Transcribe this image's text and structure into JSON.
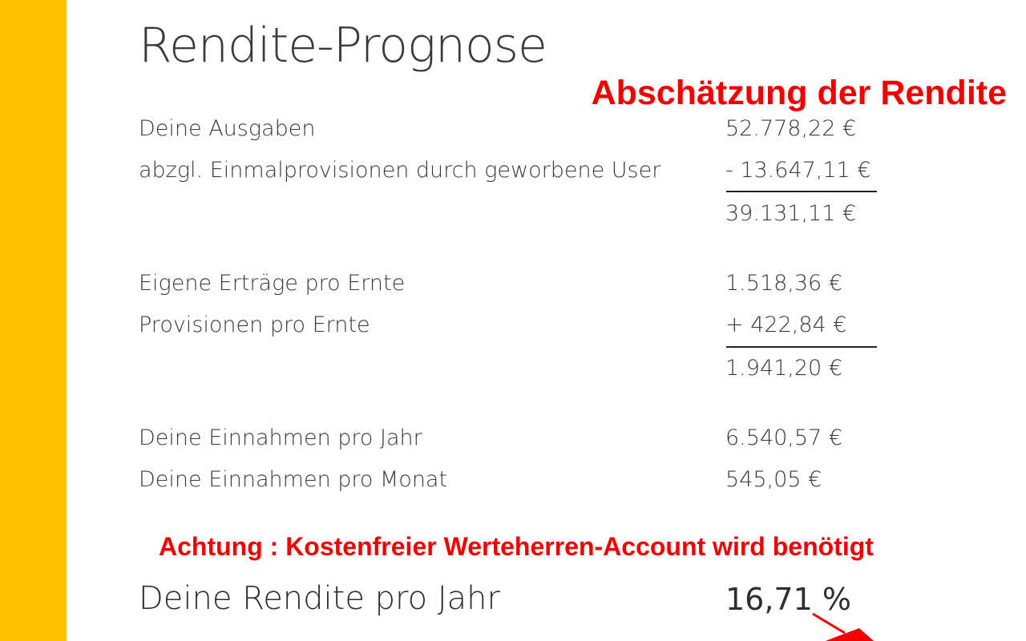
{
  "title": "Rendite-Prognose",
  "annotation_heading": "Abschätzung der Rendite",
  "annotation_warning": "Achtung : Kostenfreier Werteherren-Account wird benötigt",
  "block1": {
    "ausgaben_label": "Deine Ausgaben",
    "ausgaben_value": "52.778,22 €",
    "provision_label": "abzgl. Einmalprovisionen durch geworbene User",
    "provision_value": "- 13.647,11 €",
    "subtotal": "39.131,11 €"
  },
  "block2": {
    "ertraege_label": "Eigene Erträge pro Ernte",
    "ertraege_value": "1.518,36 €",
    "provisionen_label": "Provisionen pro Ernte",
    "provisionen_value": "+ 422,84 €",
    "subtotal": "1.941,20 €"
  },
  "block3": {
    "jahr_label": "Deine Einnahmen pro Jahr",
    "jahr_value": "6.540,57 €",
    "monat_label": "Deine Einnahmen pro Monat",
    "monat_value": "545,05 €"
  },
  "rendite": {
    "label": "Deine Rendite pro Jahr",
    "value": "16,71 %"
  },
  "colors": {
    "sidebar": "#ffc000",
    "annotation": "#f20000"
  }
}
